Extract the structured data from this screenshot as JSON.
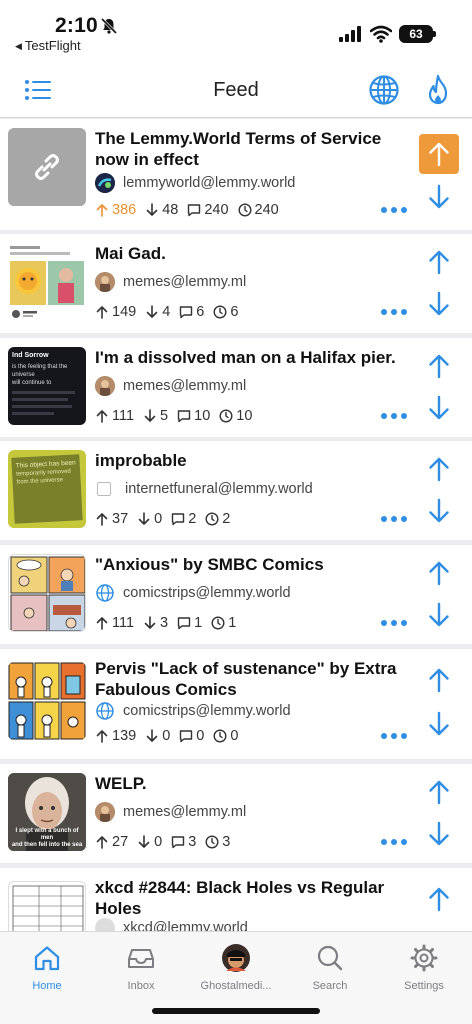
{
  "status_bar": {
    "time": "2:10",
    "back_app": "TestFlight",
    "battery": "63"
  },
  "nav": {
    "title": "Feed",
    "menu_icon": "list-icon",
    "globe_icon": "globe-icon",
    "sort_icon": "flame-icon"
  },
  "colors": {
    "accent": "#2f8ee4",
    "upvote_active": "#ef9a3a",
    "background": "#ececf0"
  },
  "posts": [
    {
      "title": "The Lemmy.World Terms of Service now in effect",
      "community": "lemmyworld@lemmy.world",
      "upvotes": "386",
      "downvotes": "48",
      "comments": "240",
      "age": "240",
      "upvoted": true
    },
    {
      "title": "Mai Gad.",
      "community": "memes@lemmy.ml",
      "upvotes": "149",
      "downvotes": "4",
      "comments": "6",
      "age": "6",
      "upvoted": false
    },
    {
      "title": "I'm a dissolved man on a Halifax pier.",
      "community": "memes@lemmy.ml",
      "upvotes": "111",
      "downvotes": "5",
      "comments": "10",
      "age": "10",
      "upvoted": false
    },
    {
      "title": "improbable",
      "community": "internetfuneral@lemmy.world",
      "upvotes": "37",
      "downvotes": "0",
      "comments": "2",
      "age": "2",
      "upvoted": false
    },
    {
      "title": "\"Anxious\" by SMBC Comics",
      "community": "comicstrips@lemmy.world",
      "upvotes": "111",
      "downvotes": "3",
      "comments": "1",
      "age": "1",
      "upvoted": false
    },
    {
      "title": "Pervis \"Lack of sustenance\" by Extra Fabulous Comics",
      "community": "comicstrips@lemmy.world",
      "upvotes": "139",
      "downvotes": "0",
      "comments": "0",
      "age": "0",
      "upvoted": false
    },
    {
      "title": "WELP.",
      "community": "memes@lemmy.ml",
      "upvotes": "27",
      "downvotes": "0",
      "comments": "3",
      "age": "3",
      "upvoted": false
    },
    {
      "title": "xkcd #2844: Black Holes vs Regular Holes",
      "community": "xkcd@lemmy.world",
      "upvoted": false
    }
  ],
  "thumb_text": {
    "post3": [
      "Ind Sorrow",
      "is the feeling that the universe",
      "will continue to"
    ],
    "post4": [
      "This object has been",
      "temporarily removed",
      "from the universe"
    ],
    "post7": [
      "I slept with a bunch of men",
      "and then fell into the sea"
    ]
  },
  "tabs": [
    {
      "label": "Home",
      "icon": "home-icon",
      "active": true
    },
    {
      "label": "Inbox",
      "icon": "inbox-icon",
      "active": false
    },
    {
      "label": "Ghostalmedi...",
      "icon": "avatar-icon",
      "active": false
    },
    {
      "label": "Search",
      "icon": "search-icon",
      "active": false
    },
    {
      "label": "Settings",
      "icon": "gear-icon",
      "active": false
    }
  ]
}
